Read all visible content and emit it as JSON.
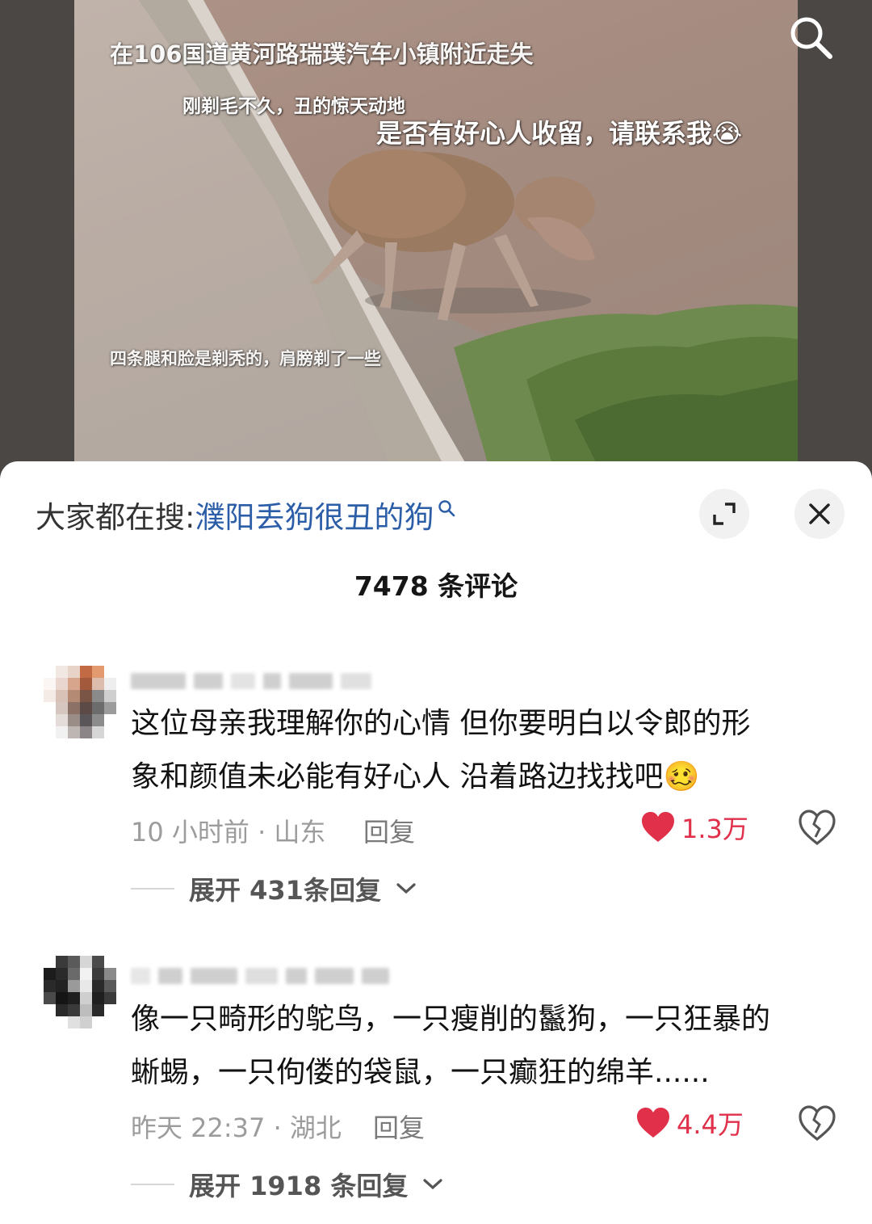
{
  "video": {
    "overlay_texts": [
      "在106国道黄河路瑞璞汽车小镇附近走失",
      "刚剃毛不久，丑的惊天动地",
      "是否有好心人收留，请联系我😭",
      "四条腿和脸是剃秃的，肩膀剃了一些"
    ],
    "search_icon": "search-icon"
  },
  "sheet": {
    "hot_search_label": "大家都在搜:",
    "hot_search_term": "濮阳丢狗很丑的狗",
    "expand_icon": "expand-icon",
    "close_icon": "close-icon",
    "comment_count": "7478 条评论"
  },
  "comments": [
    {
      "text_line1": "这位母亲我理解你的心情 但你要明白以令郎的形",
      "text_line2": "象和颜值未必能有好心人 沿着路边找找吧🥴",
      "meta": "10 小时前 · 山东",
      "reply_label": "回复",
      "likes": "1.3万",
      "expand_label": "展开 431条回复"
    },
    {
      "text_line1": "像一只畸形的鸵鸟，一只瘦削的鬣狗，一只狂暴的",
      "text_line2": "蜥蜴，一只佝偻的袋鼠，一只癫狂的绵羊......",
      "meta": "昨天 22:37 · 湖北",
      "reply_label": "回复",
      "likes": "4.4万",
      "expand_label": "展开 1918 条回复"
    }
  ],
  "colors": {
    "like": "#e0304a",
    "hot_term": "#2c5ea8"
  }
}
